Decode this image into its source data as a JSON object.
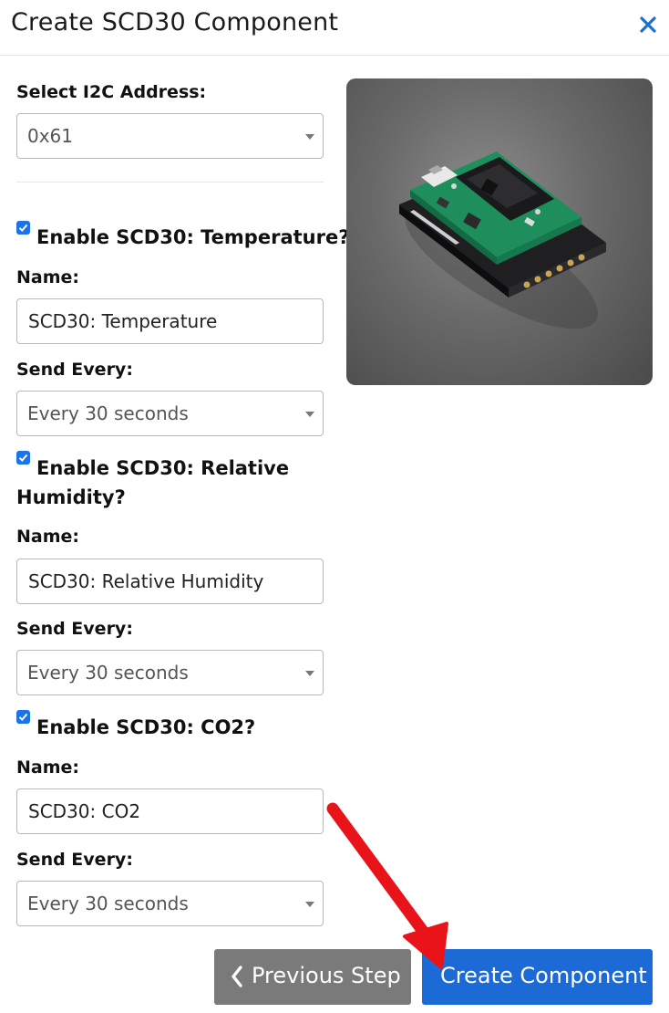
{
  "modal": {
    "title": "Create SCD30 Component",
    "close_icon": "close-icon"
  },
  "i2c": {
    "label": "Select I2C Address:",
    "value": "0x61"
  },
  "sensors": [
    {
      "enable_label": "Enable SCD30: Temperature?",
      "checked": true,
      "name_label": "Name:",
      "name_value": "SCD30: Temperature",
      "send_label": "Send Every:",
      "send_value": "Every 30 seconds"
    },
    {
      "enable_label_line1": "Enable SCD30: Relative",
      "enable_label_line2": "Humidity?",
      "checked": true,
      "name_label": "Name:",
      "name_value": "SCD30: Relative Humidity",
      "send_label": "Send Every:",
      "send_value": "Every 30 seconds"
    },
    {
      "enable_label": "Enable SCD30: CO2?",
      "checked": true,
      "name_label": "Name:",
      "name_value": "SCD30: CO2",
      "send_label": "Send Every:",
      "send_value": "Every 30 seconds"
    }
  ],
  "buttons": {
    "previous_label": "Previous Step",
    "create_label": "Create Component"
  },
  "colors": {
    "primary": "#1b6ad6",
    "secondary": "#7a7a7a",
    "close": "#1a6fd0",
    "checkbox": "#1a73e8",
    "annotation_arrow": "#e8141a"
  }
}
